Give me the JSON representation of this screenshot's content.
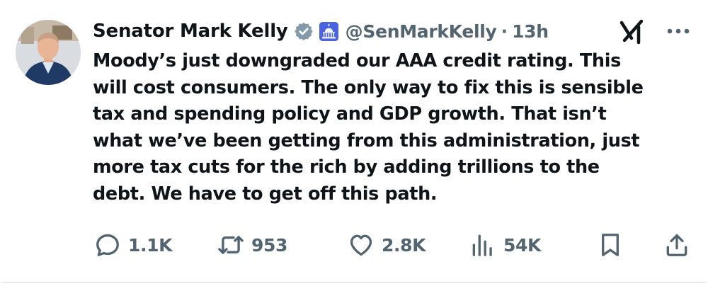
{
  "author": {
    "name": "Senator Mark Kelly",
    "handle": "@SenMarkKelly",
    "separator": "·",
    "time": "13h"
  },
  "tweet": {
    "text": "Moody’s just downgraded our AAA credit rating. This\nwill cost consumers. The only way to fix this is sensible\ntax and spending policy and GDP growth. That isn’t\nwhat we’ve been getting from this administration, just\nmore tax cuts for the rich by adding trillions to the\ndebt. We have to get off this path."
  },
  "stats": {
    "replies": "1.1K",
    "reposts": "953",
    "likes": "2.8K",
    "views": "54K"
  },
  "icons": {
    "verified": "verified-badge-icon",
    "affiliation": "capitol-building-icon",
    "grok": "grok-icon",
    "more": "more-options-icon",
    "reply": "reply-icon",
    "repost": "repost-icon",
    "like": "heart-icon",
    "views": "views-chart-icon",
    "bookmark": "bookmark-icon",
    "share": "share-icon"
  },
  "colors": {
    "text": "#0f1419",
    "secondary": "#536471",
    "verified_badge": "#829aab",
    "affiliation_badge": "#4a63e0"
  }
}
